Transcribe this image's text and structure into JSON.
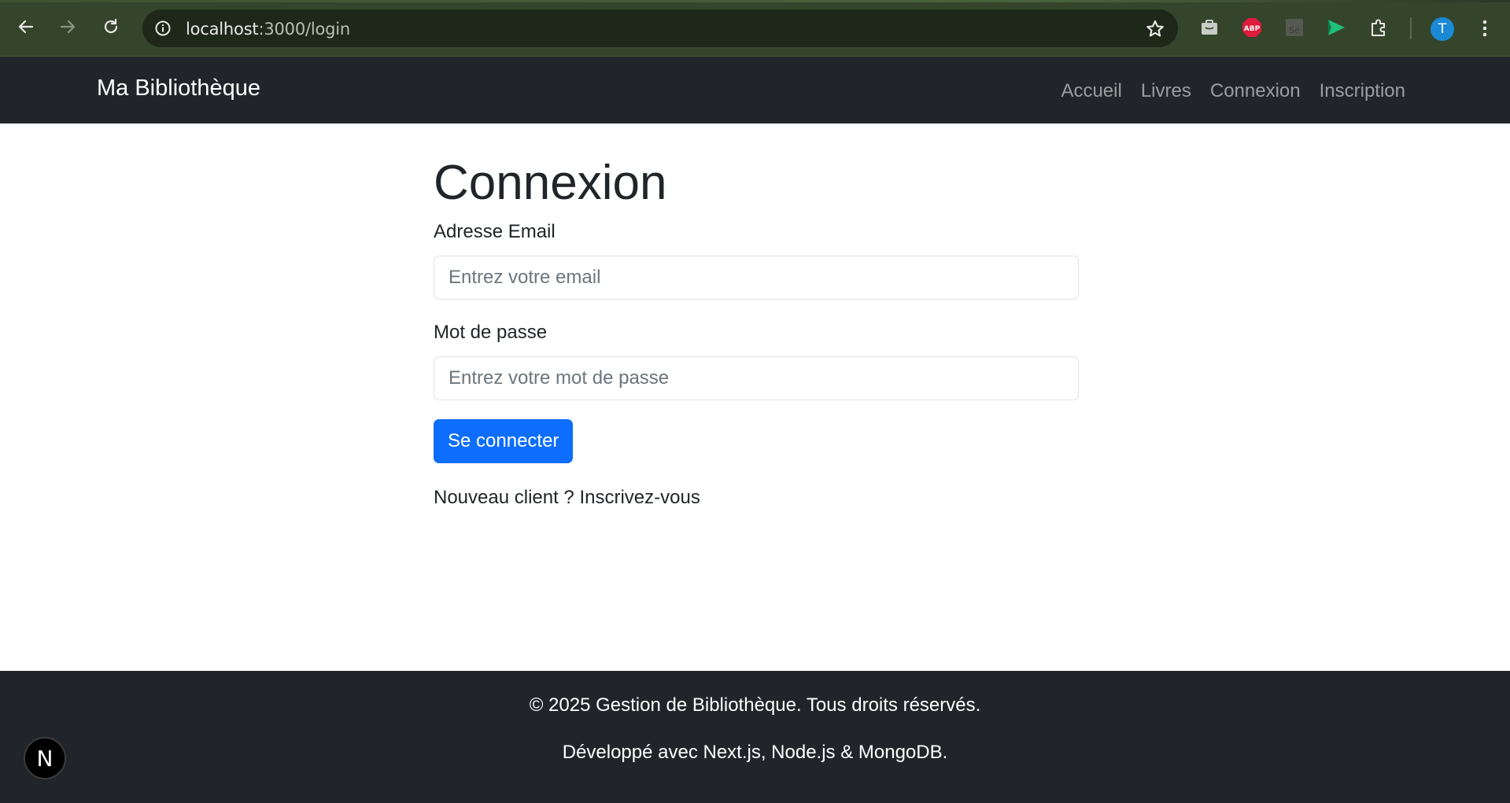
{
  "browser": {
    "url_host": "localhost",
    "url_path": ":3000/login",
    "avatar_letter": "T",
    "extensions": [
      "briefcase-icon",
      "adblock-plus-icon",
      "selenium-icon",
      "send-arrow-icon",
      "puzzle-icon"
    ],
    "colors": {
      "chrome_bg": "#35452c",
      "urlbar_bg": "#1d2818",
      "avatar": "#1a8ad6"
    }
  },
  "navbar": {
    "brand": "Ma Bibliothèque",
    "links": [
      "Accueil",
      "Livres",
      "Connexion",
      "Inscription"
    ]
  },
  "login": {
    "title": "Connexion",
    "email_label": "Adresse Email",
    "email_placeholder": "Entrez votre email",
    "email_value": "",
    "password_label": "Mot de passe",
    "password_placeholder": "Entrez votre mot de passe",
    "password_value": "",
    "submit_label": "Se connecter",
    "signup_prompt": "Nouveau client ?",
    "signup_link": "Inscrivez-vous"
  },
  "footer": {
    "copyright": "© 2025 Gestion de Bibliothèque. Tous droits réservés.",
    "tech": "Développé avec Next.js, Node.js & MongoDB."
  },
  "next_badge": {
    "letter": "N"
  },
  "colors": {
    "primary": "#0d6efd",
    "dark": "#212529"
  }
}
